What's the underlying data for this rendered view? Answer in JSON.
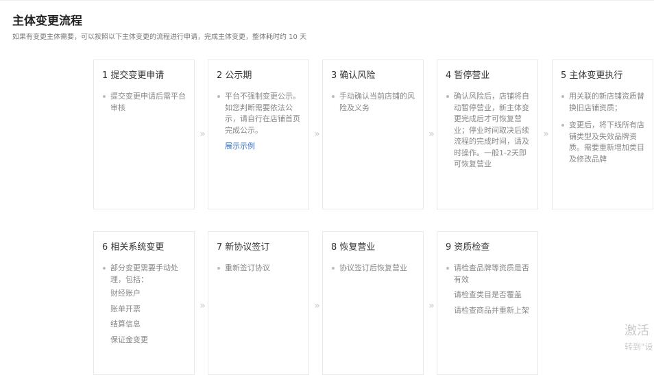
{
  "header": {
    "title": "主体变更流程",
    "subtitle": "如果有变更主体需要，可以按照以下主体变更的流程进行申请，完成主体变更，整体耗时约 10 天"
  },
  "steps": [
    {
      "title": "1 提交变更申请",
      "items": [
        "提交变更申请后需平台审核"
      ]
    },
    {
      "title": "2 公示期",
      "items": [
        "平台不强制变更公示。如您判断需要依法公示，请自行在店铺首页完成公示。"
      ],
      "link": "展示示例"
    },
    {
      "title": "3 确认风险",
      "items": [
        "手动确认当前店铺的风险及义务"
      ]
    },
    {
      "title": "4 暂停营业",
      "items": [
        "确认风险后，店铺将自动暂停营业，新主体变更完成后才可恢复营业；停业时间取决后续流程的完成时间，请及时操作。一般1-2天即可恢复营业"
      ]
    },
    {
      "title": "5 主体变更执行",
      "items": [
        "用关联的新店铺资质替换旧店铺资质；",
        "变更后，将下线所有店铺类型及失效品牌资质。需要重新增加类目及修改品牌"
      ]
    },
    {
      "title": "6 相关系统变更",
      "items": [
        "部分变更需要手动处理，包括："
      ],
      "sub_items": [
        "财经账户",
        "账单开票",
        "结算信息",
        "保证金变更"
      ]
    },
    {
      "title": "7 新协议签订",
      "items": [
        "重新签订协议"
      ]
    },
    {
      "title": "8 恢复营业",
      "items": [
        "协议签订后恢复营业"
      ]
    },
    {
      "title": "9 资质检查",
      "items": [
        "请检查品牌等资质是否有效"
      ],
      "extra_lines": [
        "请检查类目是否覆盖",
        "请检查商品并重新上架"
      ]
    }
  ],
  "arrow_glyph": "»",
  "watermark": {
    "line1": "激活",
    "line2": "转到\"设"
  }
}
